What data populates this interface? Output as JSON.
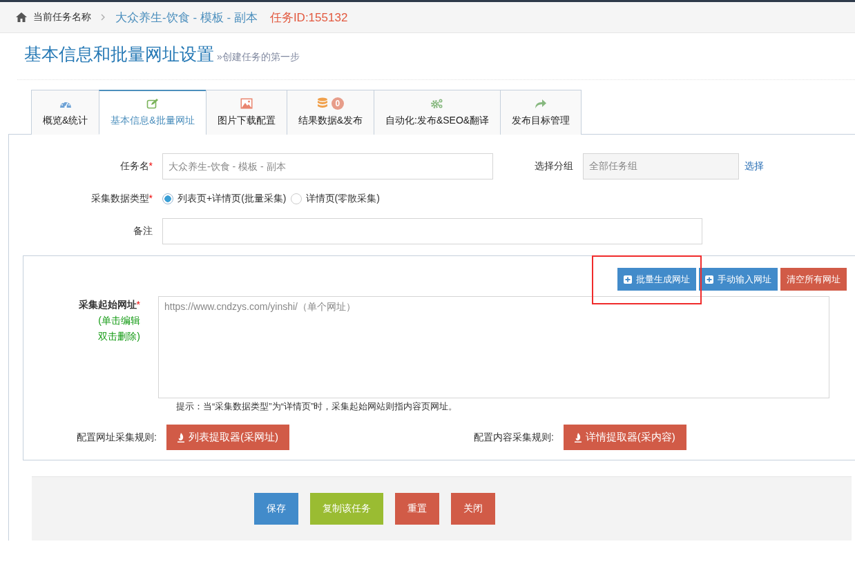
{
  "breadcrumb": {
    "home": "当前任务名称",
    "task_name": "大众养生-饮食 - 模板 - 副本",
    "task_id": "任务ID:155132"
  },
  "page_header": {
    "title": "基本信息和批量网址设置",
    "subtitle": "»创建任务的第一步"
  },
  "tabs": [
    {
      "kind": "dashboard",
      "label": "概览&统计",
      "selected": false
    },
    {
      "kind": "edit",
      "label": "基本信息&批量网址",
      "selected": true
    },
    {
      "kind": "picture",
      "label": "图片下载配置",
      "selected": false
    },
    {
      "kind": "database",
      "label": "结果数据&发布",
      "badge": "0",
      "selected": false
    },
    {
      "kind": "cogs",
      "label": "自动化:发布&SEO&翻译",
      "selected": false
    },
    {
      "kind": "share",
      "label": "发布目标管理",
      "selected": false
    }
  ],
  "form": {
    "task_name": {
      "label": "任务名",
      "mark": "*",
      "placeholder": "大众养生-饮食 - 模板 - 副本"
    },
    "group": {
      "label": "选择分组",
      "value": "全部任务组",
      "disabled": true,
      "link": "选择"
    },
    "data_type": {
      "label": "采集数据类型",
      "mark": "*",
      "options": [
        {
          "label": "列表页+详情页(批量采集)",
          "selected": true
        },
        {
          "label": "详情页(零散采集)",
          "selected": false
        }
      ]
    },
    "note": {
      "label": "备注"
    }
  },
  "start_urls": {
    "label": "采集起始网址",
    "mark": "*",
    "hint_lines": [
      "(单击编辑",
      "双击删除)"
    ],
    "actions": [
      {
        "kind": "add",
        "label": "批量生成网址",
        "highlighted": true
      },
      {
        "kind": "add",
        "label": "手动输入网址",
        "highlighted": false
      },
      {
        "kind": "danger",
        "label": "清空所有网址",
        "highlighted": false
      }
    ],
    "placeholder": "https://www.cndzys.com/yinshi/（单个网址）",
    "tip": "提示：当“采集数据类型”为“详情页”时，采集起始网站则指内容页网址。",
    "rules": [
      {
        "label": "配置网址采集规则:",
        "button": "列表提取器(采网址)"
      },
      {
        "label": "配置内容采集规则:",
        "button": "详情提取器(采内容)"
      }
    ]
  },
  "footer_buttons": [
    {
      "kind": "primary",
      "label": "保存"
    },
    {
      "kind": "success",
      "label": "复制该任务"
    },
    {
      "kind": "danger",
      "label": "重置"
    },
    {
      "kind": "danger",
      "label": "关闭"
    }
  ]
}
